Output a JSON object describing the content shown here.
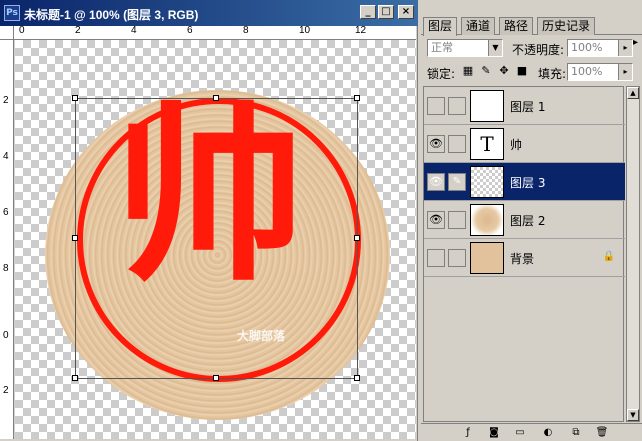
{
  "window": {
    "title": "未标题-1 @ 100% (图层 3, RGB)",
    "minimize": "_",
    "maximize": "□",
    "close": "×"
  },
  "ruler": {
    "top_labels": [
      "0",
      "2",
      "4",
      "6",
      "8",
      "10",
      "12"
    ],
    "left_labels": [
      "2",
      "4",
      "6",
      "8",
      "0",
      "2"
    ]
  },
  "canvas": {
    "character": "帅",
    "watermark1": "大脚部落",
    "watermark2": "大脚部落"
  },
  "panel": {
    "tabs": [
      "图层",
      "通道",
      "路径",
      "历史记录"
    ],
    "blend_mode": "正常",
    "opacity_label": "不透明度:",
    "opacity_value": "100%",
    "lock_label": "锁定:",
    "fill_label": "填充:",
    "fill_value": "100%",
    "layers": [
      {
        "name": "图层 1",
        "visible": false,
        "thumb": "white",
        "selected": false
      },
      {
        "name": "帅",
        "visible": true,
        "thumb": "text",
        "thumb_text": "T",
        "selected": false
      },
      {
        "name": "图层 3",
        "visible": true,
        "thumb": "transparent",
        "selected": true
      },
      {
        "name": "图层 2",
        "visible": true,
        "thumb": "wood",
        "selected": false
      },
      {
        "name": "背景",
        "visible": false,
        "thumb": "bg",
        "selected": false,
        "locked": true
      }
    ]
  },
  "colors": {
    "title_bar": "#0a246a",
    "selection": "#0a246a",
    "seal_red": "#ff1a0a",
    "wood": "#e6c9a3"
  }
}
